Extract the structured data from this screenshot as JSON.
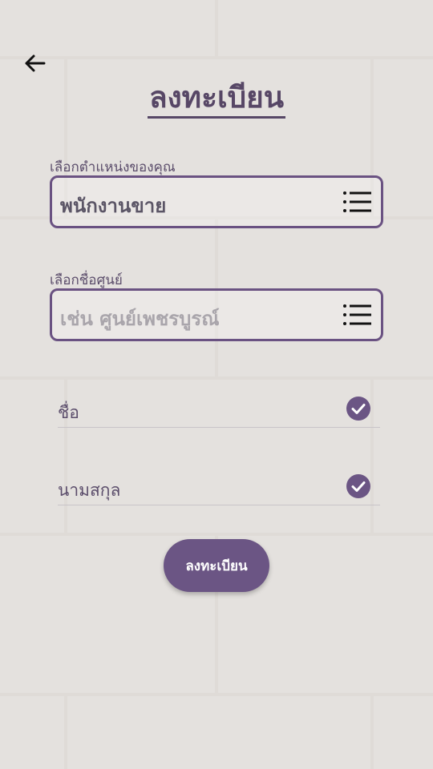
{
  "header": {
    "title": "ลงทะเบียน",
    "back_icon": "arrow-left-icon"
  },
  "position_select": {
    "label": "เลือกตำแหน่งของคุณ",
    "value": "พนักงานขาย",
    "icon": "list-icon"
  },
  "center_select": {
    "label": "เลือกชื่อศูนย์",
    "placeholder": "เช่น ศูนย์เพชรบูรณ์",
    "icon": "list-icon"
  },
  "fields": [
    {
      "label": "ชื่อ",
      "icon": "check-circle-icon"
    },
    {
      "label": "นามสกุล",
      "icon": "check-circle-icon"
    }
  ],
  "submit_button": {
    "label": "ลงทะเบียน"
  },
  "colors": {
    "accent": "#6b5584",
    "title": "#574766",
    "background": "#f2f0ee"
  }
}
